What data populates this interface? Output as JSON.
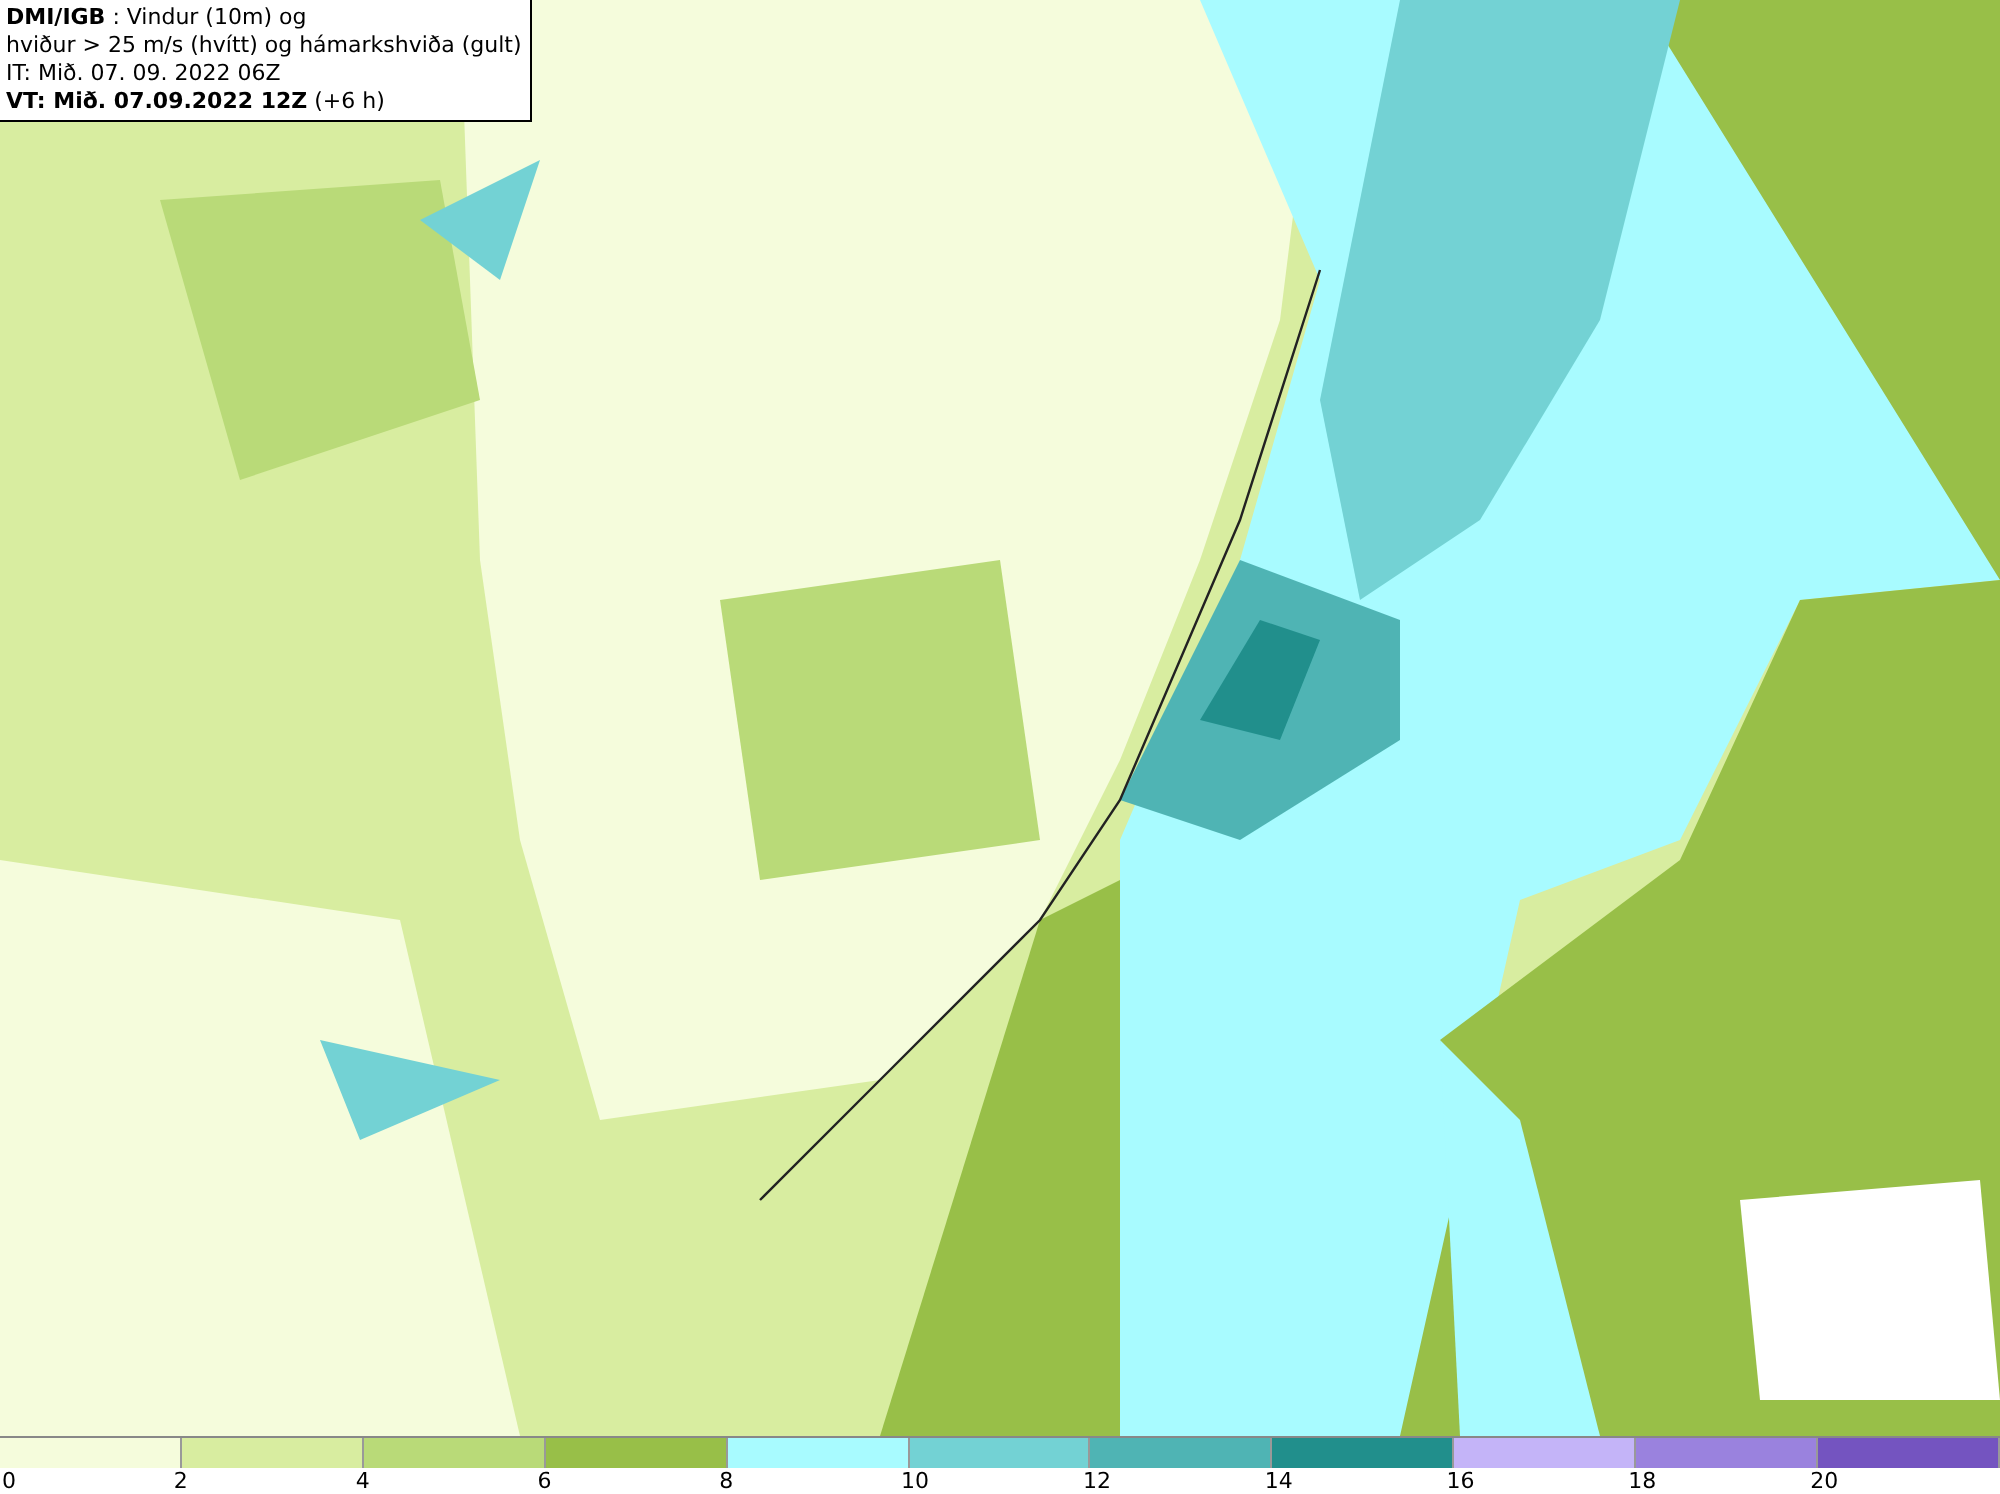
{
  "header": {
    "lines": [
      "**DMI/IGB** : Vindur (10m) og",
      "hviður > 25 m/s (hvítt) og hámarkshviða (gult)",
      "IT: Mið. 07. 09. 2022 06Z",
      "**VT: Mið. 07.09.2022 12Z** (+6 h)"
    ]
  },
  "legend": {
    "segments": [
      {
        "label": "0",
        "color": "#f5fcdc"
      },
      {
        "label": "2",
        "color": "#d8eda0"
      },
      {
        "label": "4",
        "color": "#b9da78"
      },
      {
        "label": "6",
        "color": "#98bf48"
      },
      {
        "label": "8",
        "color": "#a8fbff"
      },
      {
        "label": "10",
        "color": "#73d2d4"
      },
      {
        "label": "12",
        "color": "#4fb4b4"
      },
      {
        "label": "14",
        "color": "#218f8c"
      },
      {
        "label": "16",
        "color": "#c4b4f8"
      },
      {
        "label": "18",
        "color": "#9a82de"
      },
      {
        "label": "20",
        "color": "#7454c0"
      }
    ]
  }
}
